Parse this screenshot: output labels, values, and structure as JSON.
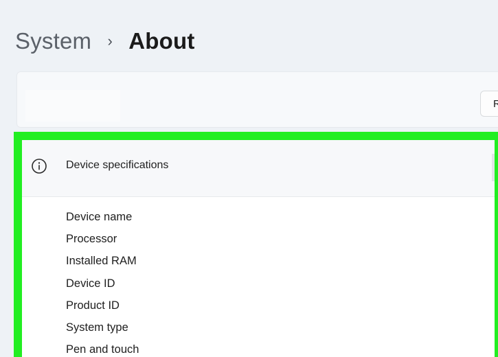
{
  "breadcrumb": {
    "parent": "System",
    "separator": "›",
    "current": "About"
  },
  "top_card": {
    "rename_button_label": "R"
  },
  "device_specifications": {
    "title": "Device specifications",
    "icon": "info-icon",
    "fields": [
      {
        "label": "Device name"
      },
      {
        "label": "Processor"
      },
      {
        "label": "Installed RAM"
      },
      {
        "label": "Device ID"
      },
      {
        "label": "Product ID"
      },
      {
        "label": "System type"
      },
      {
        "label": "Pen and touch"
      }
    ]
  },
  "colors": {
    "background": "#eef2f6",
    "card": "#f7f9fb",
    "highlight": "#22ee22",
    "text": "#1b1b1b",
    "muted_text": "#5b6169"
  }
}
